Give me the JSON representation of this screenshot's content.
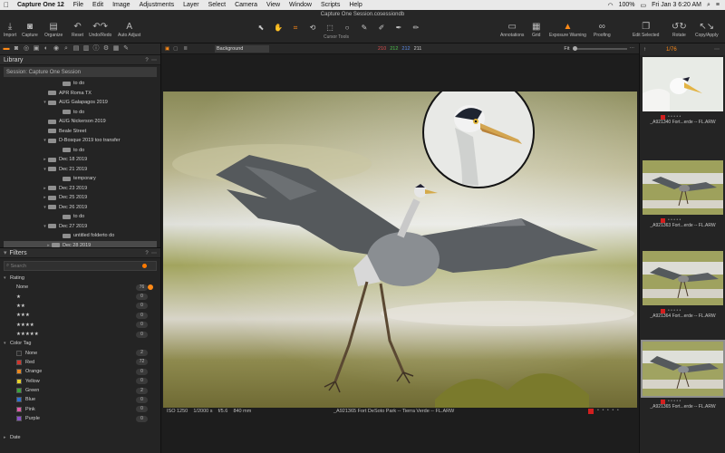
{
  "menubar": {
    "apple": "",
    "items": [
      "Capture One 12",
      "File",
      "Edit",
      "Image",
      "Adjustments",
      "Layer",
      "Select",
      "Camera",
      "View",
      "Window",
      "Scripts",
      "Help"
    ],
    "battery": "100%",
    "clock": "Fri Jan 3  6:20 AM"
  },
  "toolbar": {
    "title": "Capture One Session.cosessiondb",
    "left_buttons": [
      "Import",
      "Capture",
      "Organize",
      "Reset",
      "Undo/Redo",
      "Auto Adjust"
    ],
    "cursor_tools_label": "Cursor Tools",
    "right_buttons": [
      "Annotations",
      "Grid",
      "Exposure Warning",
      "Proofing",
      "Edit Selected",
      "Rotate",
      "Copy/Apply"
    ]
  },
  "library": {
    "title": "Library",
    "session": "Session: Capture One Session",
    "folders": [
      {
        "label": "to do",
        "depth": 2,
        "arrow": ""
      },
      {
        "label": "APR Roma TX",
        "depth": 1,
        "arrow": ""
      },
      {
        "label": "AUG Galapagos 2019",
        "depth": 1,
        "arrow": "▾"
      },
      {
        "label": "to do",
        "depth": 2,
        "arrow": ""
      },
      {
        "label": "AUG Nickerson 2019",
        "depth": 1,
        "arrow": ""
      },
      {
        "label": "Beale Street",
        "depth": 1,
        "arrow": ""
      },
      {
        "label": "D-Bosque 2019 too transfer",
        "depth": 1,
        "arrow": "▾"
      },
      {
        "label": "to do",
        "depth": 2,
        "arrow": ""
      },
      {
        "label": "Dec 18 2019",
        "depth": 1,
        "arrow": "▸"
      },
      {
        "label": "Dec 21 2019",
        "depth": 1,
        "arrow": "▾"
      },
      {
        "label": "temporary",
        "depth": 2,
        "arrow": ""
      },
      {
        "label": "Dec 23 2019",
        "depth": 1,
        "arrow": "▸"
      },
      {
        "label": "Dec 25 2019",
        "depth": 1,
        "arrow": "▸"
      },
      {
        "label": "Dec 26 2019",
        "depth": 1,
        "arrow": "▾"
      },
      {
        "label": "to do",
        "depth": 2,
        "arrow": ""
      },
      {
        "label": "Dec 27 2019",
        "depth": 1,
        "arrow": "▾"
      },
      {
        "label": "untitled folderto do",
        "depth": 2,
        "arrow": ""
      },
      {
        "label": "Dec 28 2019",
        "depth": 1,
        "arrow": "▸",
        "selected": true
      }
    ]
  },
  "filters": {
    "title": "Filters",
    "search_placeholder": "Search",
    "rating_label": "Rating",
    "ratings": [
      {
        "label": "None",
        "count": "76"
      },
      {
        "label": "★",
        "count": "0"
      },
      {
        "label": "★★",
        "count": "0"
      },
      {
        "label": "★★★",
        "count": "0"
      },
      {
        "label": "★★★★",
        "count": "0"
      },
      {
        "label": "★★★★★",
        "count": "0"
      }
    ],
    "colortag_label": "Color Tag",
    "colortags": [
      {
        "label": "None",
        "count": "2",
        "color": "#2a2a2a"
      },
      {
        "label": "Red",
        "count": "72",
        "color": "#d0342c"
      },
      {
        "label": "Orange",
        "count": "0",
        "color": "#e8871e"
      },
      {
        "label": "Yellow",
        "count": "0",
        "color": "#e6cf2a"
      },
      {
        "label": "Green",
        "count": "2",
        "color": "#3aa33c"
      },
      {
        "label": "Blue",
        "count": "0",
        "color": "#2d6fd1"
      },
      {
        "label": "Pink",
        "count": "0",
        "color": "#e05aa8"
      },
      {
        "label": "Purple",
        "count": "0",
        "color": "#8a4fc8"
      }
    ],
    "date_label": "Date"
  },
  "viewer": {
    "layer": "Background",
    "rgb": [
      "210",
      "212",
      "212",
      "211"
    ],
    "zoom": "Fit",
    "iso": "ISO 1250",
    "shutter": "1/2000 s",
    "aperture": "f/5.6",
    "focal": "840 mm",
    "filename": "_A921365 Fort DeSoto Park -- Tierra Verde -- FL.ARW"
  },
  "filmstrip": {
    "counter": "1/76",
    "thumbs": [
      "_A921340 Fort...erde -- FL.ARW",
      "_A921363 Fort...erde -- FL.ARW",
      "_A921364 Fort...erde -- FL.ARW",
      "_A921365 Fort...erde -- FL.ARW"
    ]
  },
  "colors": {
    "accent": "#ff8a17",
    "red_tag": "#d21f1f"
  }
}
